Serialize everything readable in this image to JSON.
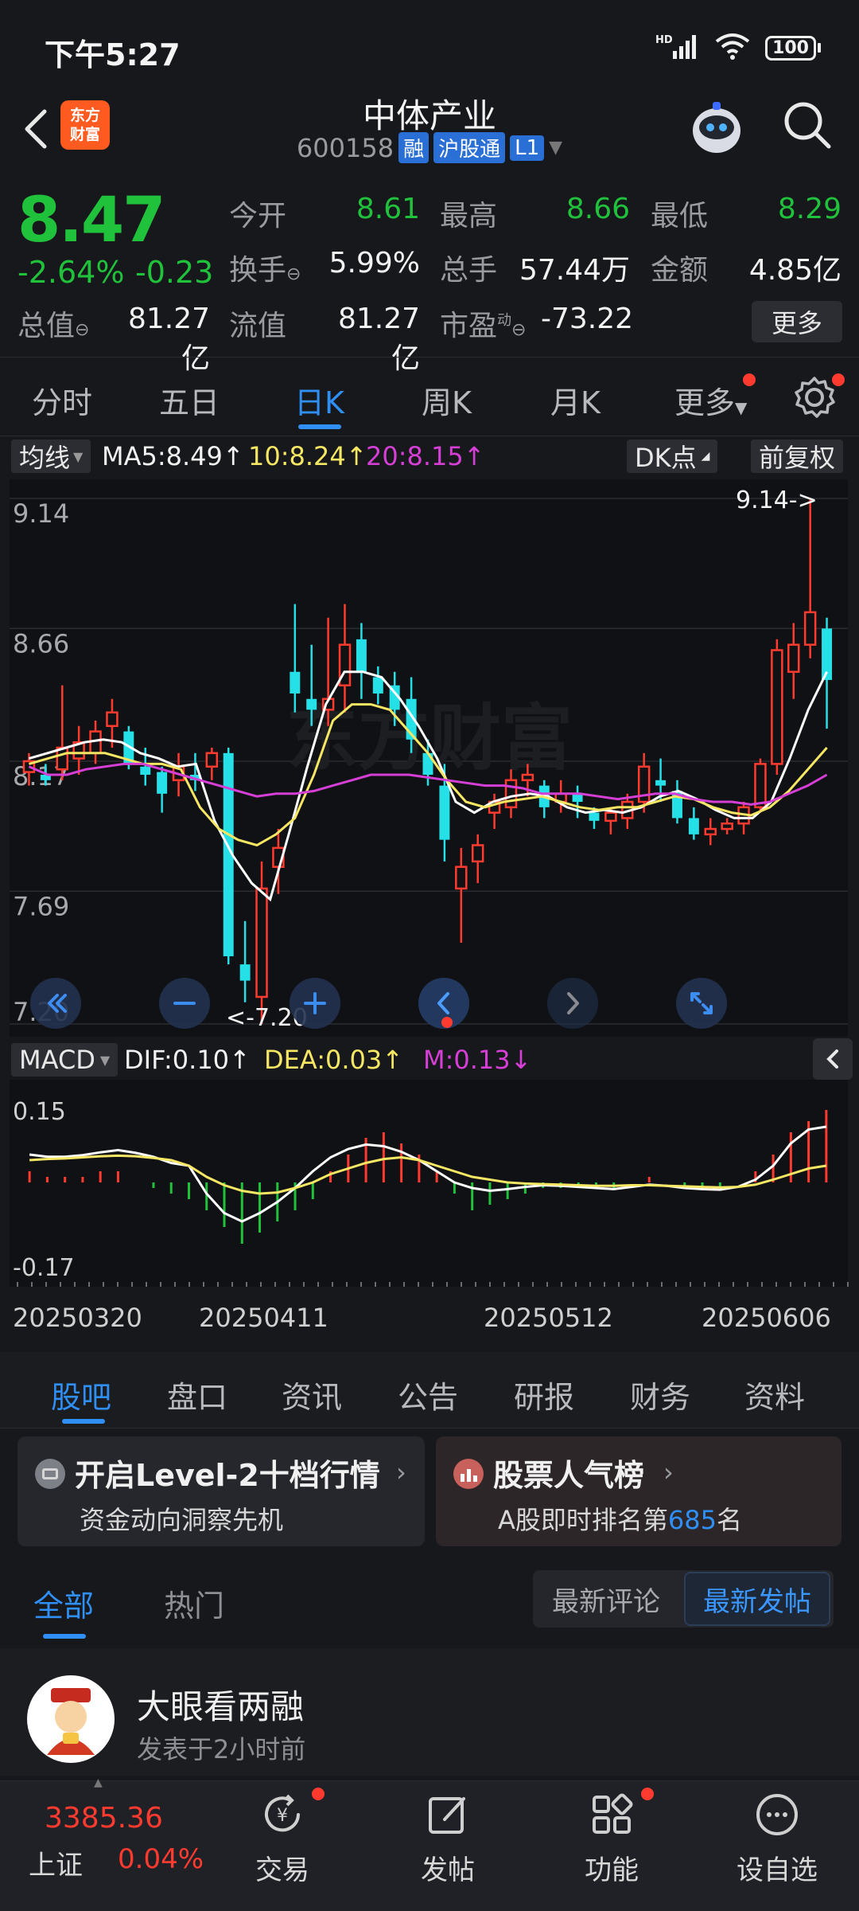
{
  "status": {
    "time": "下午5:27",
    "battery": "100",
    "network": "HD"
  },
  "header": {
    "brand_line1": "东方",
    "brand_line2": "财富",
    "stock_name": "中体产业",
    "stock_code": "600158",
    "tags": [
      "融",
      "沪股通",
      "L1"
    ]
  },
  "quote": {
    "price": "8.47",
    "change_pct": "-2.64%",
    "change_val": "-0.23",
    "open_label": "今开",
    "open": "8.61",
    "high_label": "最高",
    "high": "8.66",
    "low_label": "最低",
    "low": "8.29",
    "turnover_label": "换手",
    "turnover": "5.99%",
    "volume_label": "总手",
    "volume": "57.44万",
    "amount_label": "金额",
    "amount": "4.85亿",
    "mktcap_label": "总值",
    "mktcap": "81.27亿",
    "float_label": "流值",
    "float_cap": "81.27亿",
    "pe_label": "市盈",
    "pe_sup": "动",
    "pe": "-73.22",
    "more_label": "更多"
  },
  "period_tabs": [
    "分时",
    "五日",
    "日K",
    "周K",
    "月K",
    "更多"
  ],
  "ma_row": {
    "selector": "均线",
    "ma5": "MA5:8.49↑",
    "ma10": "10:8.24↑",
    "ma20": "20:8.15↑",
    "dk": "DK点",
    "adjust": "前复权"
  },
  "chart_data": [
    {
      "type": "candlestick",
      "title": "",
      "y_ticks": [
        "9.14",
        "8.66",
        "8.17",
        "7.69",
        "7.20"
      ],
      "ylim": [
        7.2,
        9.14
      ],
      "max_marker": "9.14->",
      "min_marker": "<-7.20",
      "watermark": "东方财富",
      "series": [
        {
          "name": "MA5",
          "color": "#ffffff",
          "values": [
            8.18,
            8.2,
            8.22,
            8.24,
            8.25,
            8.24,
            8.2,
            8.18,
            8.15,
            8.16,
            7.95,
            7.82,
            7.72,
            7.66,
            7.9,
            8.15,
            8.38,
            8.5,
            8.5,
            8.48,
            8.4,
            8.3,
            8.18,
            8.02,
            7.98,
            8.02,
            8.04,
            8.05,
            8.04,
            8.0,
            7.98,
            7.99,
            7.98,
            8.0,
            8.04,
            8.06,
            8.03,
            7.99,
            7.96,
            7.96,
            8.02,
            8.18,
            8.36,
            8.5
          ]
        },
        {
          "name": "MA10",
          "color": "#f5e663",
          "values": [
            8.16,
            8.18,
            8.2,
            8.2,
            8.2,
            8.18,
            8.16,
            8.16,
            8.14,
            8.0,
            7.92,
            7.88,
            7.86,
            7.9,
            7.96,
            8.12,
            8.32,
            8.38,
            8.38,
            8.36,
            8.28,
            8.2,
            8.1,
            8.02,
            8.0,
            8.02,
            8.03,
            8.04,
            8.02,
            8.0,
            7.99,
            8.0,
            8.0,
            8.02,
            8.04,
            8.03,
            8.0,
            7.98,
            7.97,
            8.0,
            8.06,
            8.14,
            8.22
          ]
        },
        {
          "name": "MA20",
          "color": "#d63fd6",
          "values": [
            8.15,
            8.12,
            8.12,
            8.14,
            8.15,
            8.16,
            8.16,
            8.14,
            8.12,
            8.1,
            8.08,
            8.06,
            8.04,
            8.05,
            8.05,
            8.06,
            8.08,
            8.1,
            8.12,
            8.12,
            8.12,
            8.11,
            8.1,
            8.09,
            8.08,
            8.08,
            8.07,
            8.05,
            8.05,
            8.05,
            8.04,
            8.03,
            8.04,
            8.05,
            8.05,
            8.03,
            8.02,
            8.02,
            8.01,
            8.02,
            8.05,
            8.08,
            8.12
          ]
        }
      ],
      "candles": [
        {
          "o": 8.13,
          "h": 8.2,
          "l": 8.08,
          "c": 8.17
        },
        {
          "o": 8.12,
          "h": 8.16,
          "l": 8.08,
          "c": 8.1
        },
        {
          "o": 8.14,
          "h": 8.45,
          "l": 8.1,
          "c": 8.22
        },
        {
          "o": 8.18,
          "h": 8.3,
          "l": 8.12,
          "c": 8.24
        },
        {
          "o": 8.2,
          "h": 8.32,
          "l": 8.16,
          "c": 8.28
        },
        {
          "o": 8.3,
          "h": 8.4,
          "l": 8.22,
          "c": 8.35
        },
        {
          "o": 8.28,
          "h": 8.3,
          "l": 8.14,
          "c": 8.16
        },
        {
          "o": 8.15,
          "h": 8.22,
          "l": 8.08,
          "c": 8.12
        },
        {
          "o": 8.13,
          "h": 8.15,
          "l": 7.98,
          "c": 8.05
        },
        {
          "o": 8.1,
          "h": 8.2,
          "l": 8.04,
          "c": 8.15
        },
        {
          "o": 8.12,
          "h": 8.2,
          "l": 8.06,
          "c": 8.1
        },
        {
          "o": 8.15,
          "h": 8.22,
          "l": 8.1,
          "c": 8.2
        },
        {
          "o": 8.2,
          "h": 8.22,
          "l": 7.42,
          "c": 7.45
        },
        {
          "o": 7.42,
          "h": 7.58,
          "l": 7.28,
          "c": 7.36
        },
        {
          "o": 7.3,
          "h": 7.8,
          "l": 7.2,
          "c": 7.7
        },
        {
          "o": 7.78,
          "h": 7.92,
          "l": 7.68,
          "c": 7.85
        },
        {
          "o": 8.5,
          "h": 8.75,
          "l": 8.35,
          "c": 8.42
        },
        {
          "o": 8.4,
          "h": 8.6,
          "l": 8.3,
          "c": 8.36
        },
        {
          "o": 8.36,
          "h": 8.7,
          "l": 8.3,
          "c": 8.4
        },
        {
          "o": 8.45,
          "h": 8.75,
          "l": 8.35,
          "c": 8.6
        },
        {
          "o": 8.62,
          "h": 8.68,
          "l": 8.4,
          "c": 8.5
        },
        {
          "o": 8.48,
          "h": 8.52,
          "l": 8.38,
          "c": 8.42
        },
        {
          "o": 8.45,
          "h": 8.5,
          "l": 8.3,
          "c": 8.36
        },
        {
          "o": 8.4,
          "h": 8.48,
          "l": 8.2,
          "c": 8.25
        },
        {
          "o": 8.2,
          "h": 8.25,
          "l": 8.08,
          "c": 8.12
        },
        {
          "o": 8.08,
          "h": 8.16,
          "l": 7.8,
          "c": 7.88
        },
        {
          "o": 7.7,
          "h": 7.85,
          "l": 7.5,
          "c": 7.78
        },
        {
          "o": 7.8,
          "h": 7.9,
          "l": 7.72,
          "c": 7.86
        },
        {
          "o": 7.98,
          "h": 8.05,
          "l": 7.92,
          "c": 8.02
        },
        {
          "o": 8.0,
          "h": 8.14,
          "l": 7.96,
          "c": 8.1
        },
        {
          "o": 8.1,
          "h": 8.16,
          "l": 8.04,
          "c": 8.12
        },
        {
          "o": 8.08,
          "h": 8.1,
          "l": 7.96,
          "c": 8.0
        },
        {
          "o": 8.02,
          "h": 8.1,
          "l": 7.98,
          "c": 8.05
        },
        {
          "o": 8.05,
          "h": 8.08,
          "l": 7.96,
          "c": 8.02
        },
        {
          "o": 7.98,
          "h": 8.0,
          "l": 7.92,
          "c": 7.95
        },
        {
          "o": 7.95,
          "h": 8.0,
          "l": 7.9,
          "c": 7.98
        },
        {
          "o": 7.96,
          "h": 8.05,
          "l": 7.92,
          "c": 8.02
        },
        {
          "o": 8.02,
          "h": 8.2,
          "l": 7.98,
          "c": 8.15
        },
        {
          "o": 8.1,
          "h": 8.18,
          "l": 8.02,
          "c": 8.08
        },
        {
          "o": 8.06,
          "h": 8.1,
          "l": 7.94,
          "c": 7.96
        },
        {
          "o": 7.96,
          "h": 8.0,
          "l": 7.88,
          "c": 7.9
        },
        {
          "o": 7.9,
          "h": 7.96,
          "l": 7.86,
          "c": 7.92
        },
        {
          "o": 7.92,
          "h": 7.96,
          "l": 7.9,
          "c": 7.94
        },
        {
          "o": 7.94,
          "h": 8.02,
          "l": 7.9,
          "c": 8.0
        },
        {
          "o": 8.0,
          "h": 8.18,
          "l": 7.98,
          "c": 8.16
        },
        {
          "o": 8.16,
          "h": 8.62,
          "l": 8.12,
          "c": 8.58
        },
        {
          "o": 8.5,
          "h": 8.68,
          "l": 8.4,
          "c": 8.6
        },
        {
          "o": 8.6,
          "h": 9.14,
          "l": 8.55,
          "c": 8.72
        },
        {
          "o": 8.66,
          "h": 8.7,
          "l": 8.29,
          "c": 8.47
        }
      ]
    },
    {
      "type": "bar",
      "title": "",
      "indicator": "MACD",
      "dif_label": "DIF:0.10↑",
      "dea_label": "DEA:0.03↑",
      "m_label": "M:0.13↓",
      "y_ticks": [
        "0.15",
        "-0.17"
      ],
      "ylim": [
        -0.17,
        0.15
      ],
      "x_ticks": [
        "20250320",
        "20250411",
        "20250512",
        "20250606"
      ],
      "series": [
        {
          "name": "DIF",
          "color": "#ffffff",
          "values": [
            0.05,
            0.046,
            0.046,
            0.049,
            0.054,
            0.058,
            0.053,
            0.046,
            0.035,
            0.03,
            -0.02,
            -0.055,
            -0.07,
            -0.055,
            -0.035,
            -0.01,
            0.02,
            0.045,
            0.06,
            0.068,
            0.065,
            0.055,
            0.04,
            0.02,
            0.0,
            -0.01,
            -0.015,
            -0.012,
            -0.008,
            -0.005,
            -0.006,
            -0.008,
            -0.01,
            -0.012,
            -0.008,
            -0.004,
            -0.006,
            -0.01,
            -0.012,
            -0.013,
            -0.008,
            0.005,
            0.03,
            0.07,
            0.095,
            0.1
          ]
        },
        {
          "name": "DEA",
          "color": "#f5e663",
          "values": [
            0.04,
            0.042,
            0.043,
            0.045,
            0.047,
            0.048,
            0.047,
            0.044,
            0.04,
            0.03,
            0.01,
            -0.005,
            -0.015,
            -0.02,
            -0.018,
            -0.01,
            0.0,
            0.015,
            0.025,
            0.035,
            0.042,
            0.045,
            0.04,
            0.03,
            0.02,
            0.01,
            0.005,
            0.0,
            -0.002,
            -0.003,
            -0.004,
            -0.005,
            -0.006,
            -0.006,
            -0.005,
            -0.005,
            -0.006,
            -0.007,
            -0.008,
            -0.009,
            -0.008,
            -0.004,
            0.005,
            0.015,
            0.025,
            0.03
          ]
        },
        {
          "name": "M",
          "color": "#ff3b30",
          "values": [
            0.02,
            0.01,
            0.01,
            0.01,
            0.02,
            0.02,
            0.0,
            -0.01,
            -0.02,
            -0.03,
            -0.05,
            -0.08,
            -0.11,
            -0.09,
            -0.07,
            -0.05,
            -0.03,
            0.02,
            0.05,
            0.08,
            0.09,
            0.07,
            0.05,
            0.02,
            -0.02,
            -0.05,
            -0.04,
            -0.03,
            -0.02,
            -0.01,
            -0.01,
            -0.01,
            -0.01,
            -0.01,
            0.0,
            0.01,
            0.0,
            -0.01,
            -0.01,
            -0.01,
            0.0,
            0.02,
            0.05,
            0.09,
            0.11,
            0.13
          ]
        }
      ]
    }
  ],
  "chart_controls": [
    "page-left",
    "zoom-out",
    "zoom-in",
    "step-left",
    "step-right",
    "fullscreen"
  ],
  "section_tabs": [
    "股吧",
    "盘口",
    "资讯",
    "公告",
    "研报",
    "财务",
    "资料"
  ],
  "promo": {
    "left_title": "开启Level-2十档行情",
    "left_sub": "资金动向洞察先机",
    "right_title": "股票人气榜",
    "right_sub_prefix": "A股即时排名第",
    "right_sub_rank": "685",
    "right_sub_suffix": "名"
  },
  "feed": {
    "tabs": [
      "全部",
      "热门"
    ],
    "sort_latest_comment": "最新评论",
    "sort_latest_post": "最新发帖"
  },
  "post": {
    "author": "大眼看两融",
    "time": "发表于2小时前"
  },
  "bottom_nav": {
    "index_value": "3385.36",
    "index_name": "上证",
    "index_change": "0.04%",
    "items": [
      "交易",
      "发帖",
      "功能",
      "设自选"
    ]
  },
  "colors": {
    "up": "#ff3b30",
    "down": "#21c23b",
    "accent": "#2f8ff5",
    "down_candle": "#26e0e8"
  }
}
